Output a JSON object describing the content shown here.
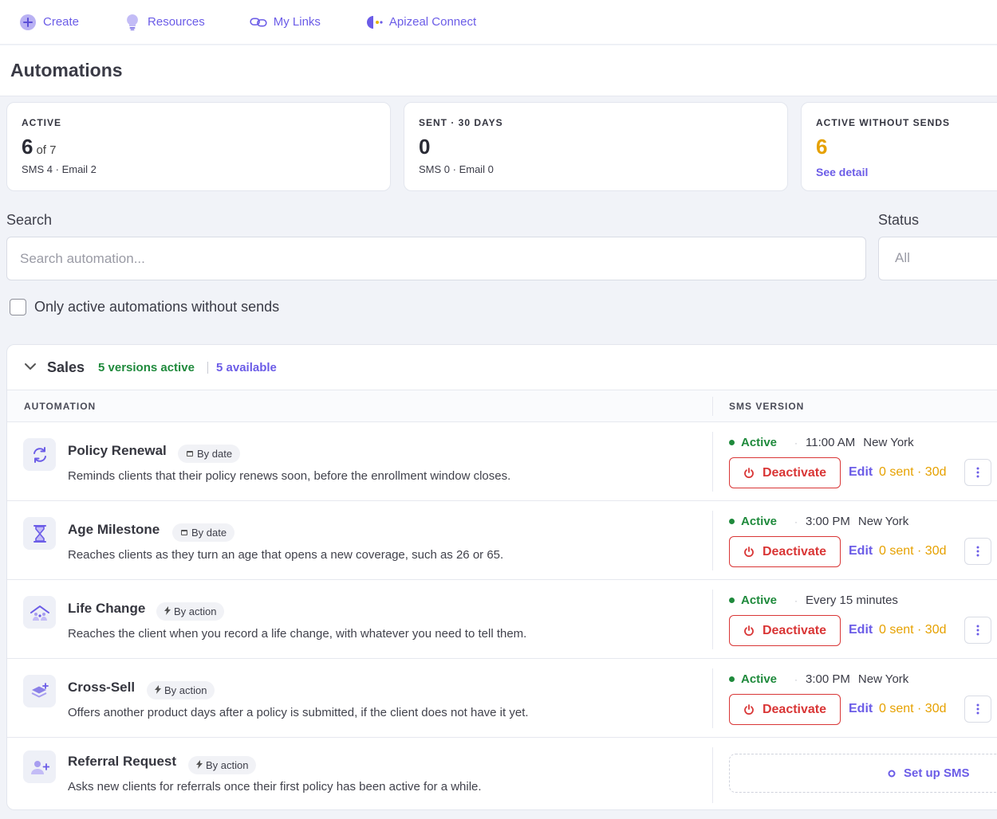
{
  "nav": {
    "items": [
      {
        "label": "Create",
        "icon": "plus-circle-icon"
      },
      {
        "label": "Resources",
        "icon": "lightbulb-icon"
      },
      {
        "label": "My Links",
        "icon": "link-icon"
      },
      {
        "label": "Apizeal Connect",
        "icon": "connect-icon"
      }
    ]
  },
  "page": {
    "title": "Automations"
  },
  "stats": {
    "active": {
      "label": "ACTIVE",
      "value": "6",
      "of": "of 7",
      "sub": "SMS 4 · Email 2"
    },
    "sent": {
      "label": "SENT · 30 DAYS",
      "value": "0",
      "sub": "SMS 0 · Email 0"
    },
    "without_sends": {
      "label": "ACTIVE WITHOUT SENDS",
      "value": "6",
      "link": "See detail",
      "value_color": "#e6a100"
    }
  },
  "filters": {
    "search_label": "Search",
    "search_placeholder": "Search automation...",
    "status_label": "Status",
    "status_value": "All",
    "checkbox_label": "Only active automations without sends",
    "checkbox_checked": false
  },
  "group": {
    "name": "Sales",
    "active": "5 versions active",
    "available": "5 available",
    "col_automation": "AUTOMATION",
    "col_sms": "SMS VERSION"
  },
  "rows": [
    {
      "title": "Policy Renewal",
      "tag": "By date",
      "tag_icon": "calendar-icon",
      "icon": "refresh-icon",
      "desc": "Reminds clients that their policy renews soon, before the enrollment window closes.",
      "status": "Active",
      "time": "11:00 AM",
      "tz": "New York",
      "action": "Deactivate",
      "edit": "Edit",
      "sent": "0 sent · 30d"
    },
    {
      "title": "Age Milestone",
      "tag": "By date",
      "tag_icon": "calendar-icon",
      "icon": "hourglass-icon",
      "desc": "Reaches clients as they turn an age that opens a new coverage, such as 26 or 65.",
      "status": "Active",
      "time": "3:00 PM",
      "tz": "New York",
      "action": "Deactivate",
      "edit": "Edit",
      "sent": "0 sent · 30d"
    },
    {
      "title": "Life Change",
      "tag": "By action",
      "tag_icon": "bolt-icon",
      "icon": "family-icon",
      "desc": "Reaches the client when you record a life change, with whatever you need to tell them.",
      "status": "Active",
      "time": "Every 15 minutes",
      "tz": "",
      "action": "Deactivate",
      "edit": "Edit",
      "sent": "0 sent · 30d"
    },
    {
      "title": "Cross-Sell",
      "tag": "By action",
      "tag_icon": "bolt-icon",
      "icon": "layers-plus-icon",
      "desc": "Offers another product days after a policy is submitted, if the client does not have it yet.",
      "status": "Active",
      "time": "3:00 PM",
      "tz": "New York",
      "action": "Deactivate",
      "edit": "Edit",
      "sent": "0 sent · 30d"
    },
    {
      "title": "Referral Request",
      "tag": "By action",
      "tag_icon": "bolt-icon",
      "icon": "user-plus-icon",
      "desc": "Asks new clients for referrals once their first policy has been active for a while.",
      "setup": "Set up SMS"
    }
  ],
  "colors": {
    "accent": "#6b5ce7",
    "success": "#1f8a3c",
    "danger": "#d93636",
    "warning": "#e6a100"
  }
}
